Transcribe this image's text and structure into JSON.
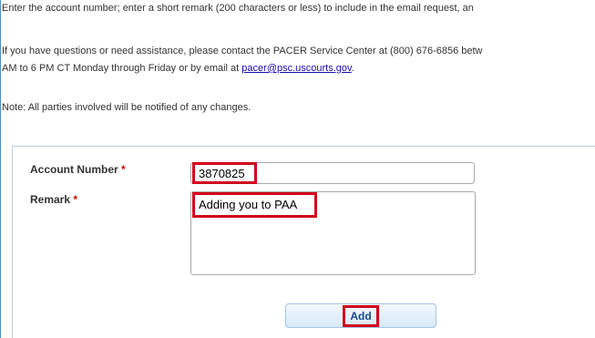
{
  "instructions": {
    "line1": "Enter the account number; enter a short remark (200 characters or less) to include in the email request, an",
    "contact_line1": "If you have questions or need assistance, please contact the PACER Service Center at (800) 676-6856 betw",
    "contact_line2_prefix": "AM to 6 PM CT Monday through Friday or by email at ",
    "contact_email": "pacer@psc.uscourts.gov",
    "contact_line2_suffix": ".",
    "note": "Note: All parties involved will be notified of any changes."
  },
  "form": {
    "account_label": "Account Number",
    "account_value": "3870825",
    "remark_label": "Remark",
    "remark_value": "Adding you to PAA",
    "required_marker": "*",
    "add_button_label": "Add"
  },
  "colors": {
    "highlight": "#d0021b",
    "required": "#cc0000",
    "link": "#1a0dab"
  }
}
